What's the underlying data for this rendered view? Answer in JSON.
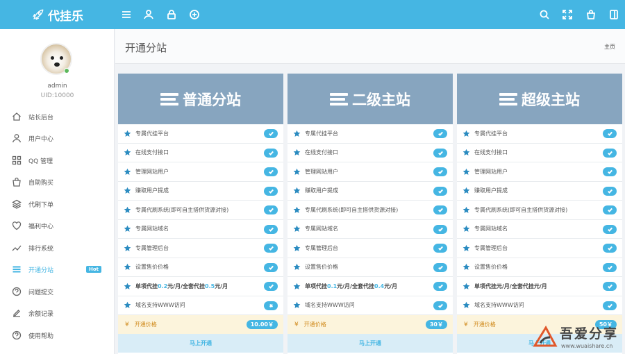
{
  "app": {
    "title": "代挂乐"
  },
  "topbar": {
    "left_icons": [
      "menu-icon",
      "user-icon",
      "lock-icon",
      "plus-circle-icon"
    ],
    "right_icons": [
      "search-icon",
      "fullscreen-icon",
      "shopping-bag-icon",
      "sidebar-toggle-icon"
    ]
  },
  "user": {
    "name": "admin",
    "uid": "UID:10000"
  },
  "sidebar": {
    "items": [
      {
        "label": "站长后台",
        "icon": "home-icon"
      },
      {
        "label": "用户中心",
        "icon": "user-icon"
      },
      {
        "label": "QQ 管理",
        "icon": "grid-icon"
      },
      {
        "label": "自助购买",
        "icon": "shopping-bag-icon"
      },
      {
        "label": "代刷下单",
        "icon": "layers-icon"
      },
      {
        "label": "福利中心",
        "icon": "heart-icon"
      },
      {
        "label": "排行系统",
        "icon": "trend-icon"
      },
      {
        "label": "开通分站",
        "icon": "list-icon",
        "badge": "Hot",
        "active": true
      },
      {
        "label": "问题提交",
        "icon": "question-icon"
      },
      {
        "label": "余额记录",
        "icon": "edit-icon"
      },
      {
        "label": "使用帮助",
        "icon": "help-circle-icon"
      }
    ]
  },
  "header": {
    "title": "开通分站",
    "breadcrumb": "主页"
  },
  "cards": [
    {
      "title": "普通分站",
      "features": [
        "专属代挂平台",
        "在线支付接口",
        "管理网站用户",
        "赚取用户提成",
        "专属代刷系统(即可自主搭供货源对接)",
        "专属网站域名",
        "专属管理后台",
        "设置售价价格"
      ],
      "rate": {
        "pre": "单项代挂",
        "a": "0.2",
        "mid": "元/月/全套代挂",
        "b": "0.5",
        "post": "元/月"
      },
      "domain": "域名支持WWW访问",
      "domain_supported": false,
      "price_label": "开通价格",
      "price": "10.00￥",
      "buy_label": "马上开通"
    },
    {
      "title": "二级主站",
      "features": [
        "专属代挂平台",
        "在线支付接口",
        "管理网站用户",
        "赚取用户提成",
        "专属代刷系统(即可自主搭供货源对接)",
        "专属网站域名",
        "专属管理后台",
        "设置售价价格"
      ],
      "rate": {
        "pre": "单项代挂",
        "a": "0.1",
        "mid": "元/月/全套代挂",
        "b": "0.4",
        "post": "元/月"
      },
      "domain": "域名支持WWW访问",
      "domain_supported": true,
      "price_label": "开通价格",
      "price": "30￥",
      "buy_label": "马上开通"
    },
    {
      "title": "超级主站",
      "features": [
        "专属代挂平台",
        "在线支付接口",
        "管理网站用户",
        "赚取用户提成",
        "专属代刷系统(即可自主搭供货源对接)",
        "专属网站域名",
        "专属管理后台",
        "设置售价价格"
      ],
      "rate": {
        "pre": "单项代挂",
        "a": "",
        "mid": "元/月/全套代挂",
        "b": "",
        "post": "元/月"
      },
      "domain": "域名支持WWW访问",
      "domain_supported": true,
      "price_label": "开通价格",
      "price": "50￥",
      "buy_label": "马上开通"
    }
  ],
  "watermark": {
    "title": "吾爱分享",
    "url": "www.wuaishare.cn"
  },
  "colors": {
    "accent": "#45b6e3",
    "card_header": "#87a5bf",
    "price_bg": "#fcf4dc",
    "buy_bg": "#d9edf7"
  }
}
